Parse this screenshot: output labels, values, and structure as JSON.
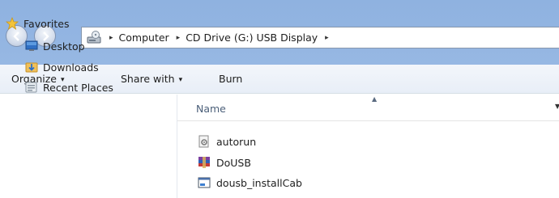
{
  "address": {
    "breadcrumbs": [
      "Computer",
      "CD Drive (G:) USB Display"
    ],
    "separator": "▸"
  },
  "commands": {
    "organize": "Organize",
    "share_with": "Share with",
    "burn": "Burn",
    "caret": "▾"
  },
  "nav": {
    "favorites": "Favorites",
    "items": [
      "Desktop",
      "Downloads",
      "Recent Places"
    ]
  },
  "columns": {
    "name": "Name"
  },
  "files": [
    {
      "name": "autorun",
      "icon": "settings-file-icon"
    },
    {
      "name": "DoUSB",
      "icon": "archive-icon"
    },
    {
      "name": "dousb_installCab",
      "icon": "installer-icon"
    }
  ],
  "colors": {
    "band": "#93b5e2",
    "address_border": "#8797ad",
    "header_text": "#4c607a"
  }
}
